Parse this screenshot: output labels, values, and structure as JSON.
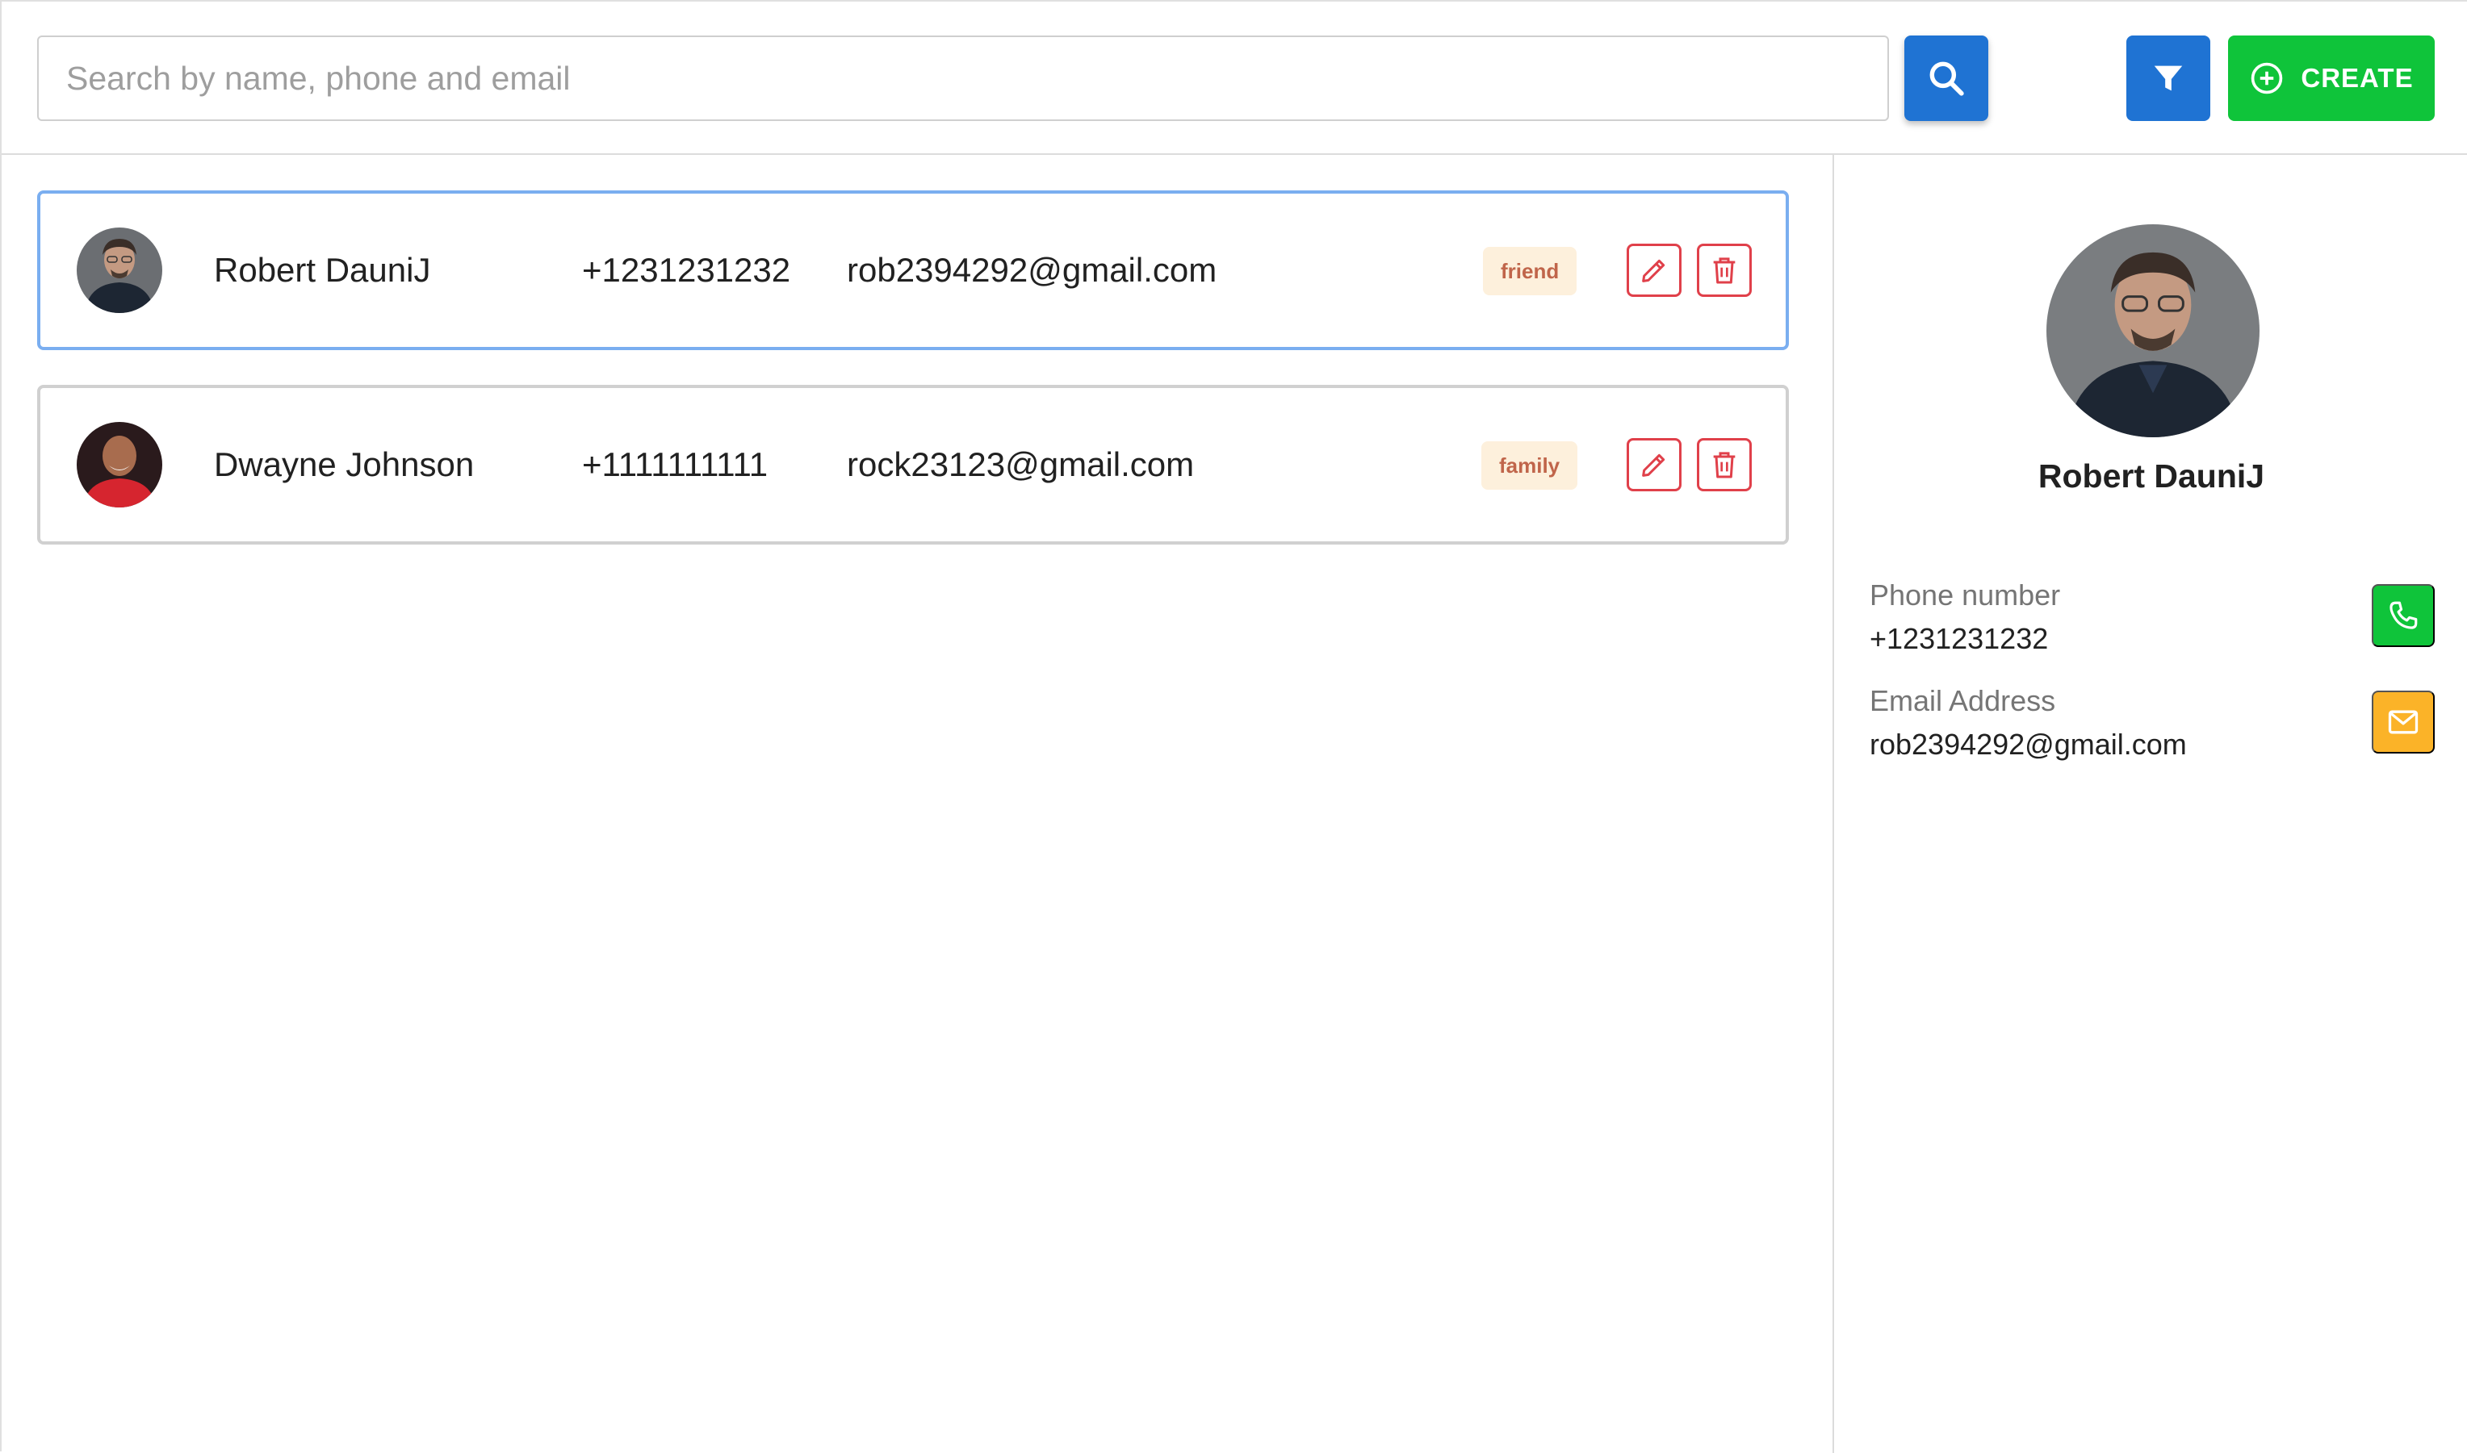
{
  "search": {
    "placeholder": "Search by name, phone and email",
    "value": ""
  },
  "toolbar": {
    "create_label": "CREATE"
  },
  "contacts": [
    {
      "name": "Robert DauniJ",
      "phone": "+1231231232",
      "email": "rob2394292@gmail.com",
      "tag": "friend",
      "selected": true
    },
    {
      "name": "Dwayne Johnson",
      "phone": "+1111111111",
      "email": "rock23123@gmail.com",
      "tag": "family",
      "selected": false
    }
  ],
  "detail": {
    "name": "Robert DauniJ",
    "phone_label": "Phone number",
    "phone_value": "+1231231232",
    "email_label": "Email Address",
    "email_value": "rob2394292@gmail.com"
  },
  "icons": {
    "search": "search-icon",
    "filter": "filter-icon",
    "create": "plus-circle-icon",
    "edit": "pencil-icon",
    "delete": "trash-icon",
    "call": "phone-icon",
    "mail": "mail-icon"
  },
  "colors": {
    "primary": "#1f73d3",
    "success": "#0fc43a",
    "warning": "#fbb328",
    "danger": "#e0404a",
    "selected_border": "#7aaef0",
    "tag_bg": "#fdf0dc",
    "tag_text": "#c0654a"
  }
}
